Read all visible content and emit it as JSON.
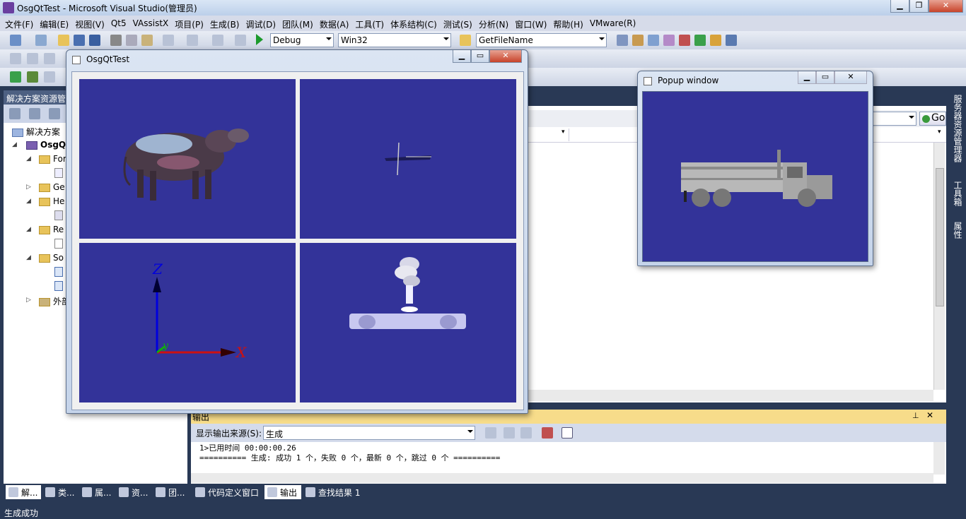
{
  "window": {
    "title": "OsgQtTest - Microsoft Visual Studio(管理员)"
  },
  "menu": [
    "文件(F)",
    "编辑(E)",
    "视图(V)",
    "Qt5",
    "VAssistX",
    "项目(P)",
    "生成(B)",
    "调试(D)",
    "团队(M)",
    "数据(A)",
    "工具(T)",
    "体系结构(C)",
    "测试(S)",
    "分析(N)",
    "窗口(W)",
    "帮助(H)",
    "VMware(R)"
  ],
  "toolbar": {
    "config": "Debug",
    "platform": "Win32",
    "find_box": "GetFileName"
  },
  "solution_explorer": {
    "title": "解决方案资源管",
    "items": [
      {
        "label": "解决方案"
      },
      {
        "label": "OsgQ"
      },
      {
        "label": "For"
      },
      {
        "label": "Ge"
      },
      {
        "label": "He"
      },
      {
        "label": "Re"
      },
      {
        "label": "So"
      },
      {
        "label": "外部"
      }
    ]
  },
  "editor": {
    "go_button": "Go"
  },
  "output": {
    "title": "输出",
    "source_label": "显示输出来源(S):",
    "source_value": "生成",
    "lines": [
      "1>已用时间 00:00:00.26",
      "========== 生成: 成功 1 个，失败 0 个，最新 0 个，跳过 0 个 =========="
    ]
  },
  "bottom_tabs": [
    "解...",
    "类...",
    "属...",
    "资...",
    "团...",
    "代码定义窗口",
    "输出",
    "查找结果 1"
  ],
  "status": "生成成功",
  "right_strip": [
    "服务器资源管理器",
    "工具箱",
    "属性"
  ],
  "osg_window": {
    "title": "OsgQtTest",
    "axis_labels": {
      "z": "Z",
      "y": "y",
      "x": "X"
    }
  },
  "popup_window": {
    "title": "Popup window"
  },
  "colors": {
    "viewport": "#333399",
    "vs_chrome": "#293955"
  }
}
